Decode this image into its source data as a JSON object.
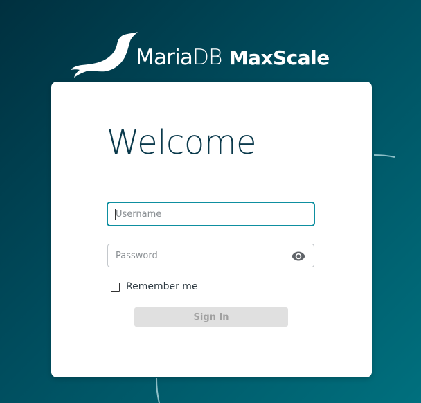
{
  "brand": {
    "name_part1": "Maria",
    "name_part2": "DB",
    "product": "MaxScale",
    "logo_icon": "seal-icon"
  },
  "login": {
    "heading": "Welcome",
    "username": {
      "value": "",
      "placeholder": "Username",
      "focused": true
    },
    "password": {
      "value": "",
      "placeholder": "Password",
      "toggle_icon": "eye-icon"
    },
    "remember_me": {
      "label": "Remember me",
      "checked": false
    },
    "submit": {
      "label": "Sign In",
      "disabled": true
    }
  },
  "colors": {
    "background_dark": "#00303f",
    "background_light": "#00707e",
    "heading": "#0b3a4c",
    "focus_border": "#0e8fa0",
    "button_disabled_bg": "#e0e0e0",
    "button_disabled_text": "#a0a0a0"
  }
}
